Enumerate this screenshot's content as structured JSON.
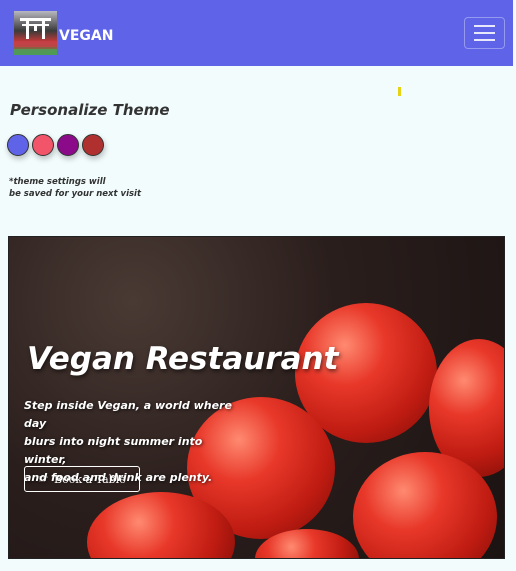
{
  "navbar": {
    "brand": "VEGAN",
    "logo_icon": "torii-gate-icon",
    "toggler_icon": "hamburger-menu-icon"
  },
  "theme": {
    "title": "Personalize Theme",
    "swatches": [
      "#5f63e8",
      "#f2546a",
      "#8a0a8a",
      "#b03030"
    ],
    "note_line1": "*theme settings will",
    "note_line2": "be saved for your next visit"
  },
  "hero": {
    "heading": "Vegan Restaurant",
    "text_line1": "Step inside Vegan, a world where day",
    "text_line2": "blurs into night summer into winter,",
    "text_line3": "and food and drink are plenty.",
    "button_label": "Book a Table",
    "button_icon": "hand-pointer-icon"
  }
}
